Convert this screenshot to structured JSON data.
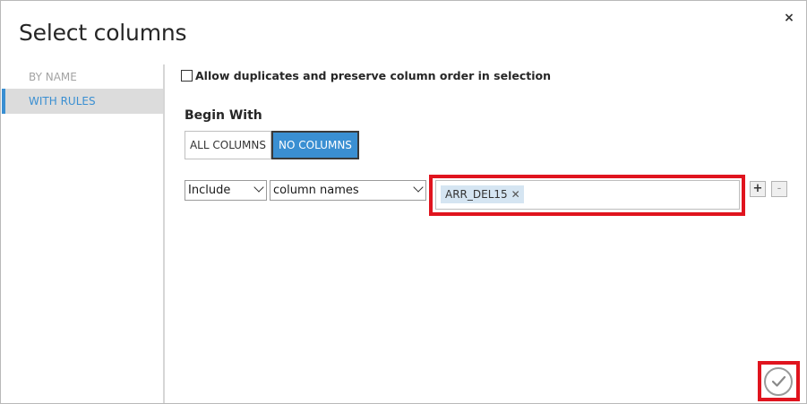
{
  "dialog": {
    "title": "Select columns",
    "close_icon": "close-icon",
    "close_glyph": "×"
  },
  "sidebar": {
    "items": [
      {
        "label": "BY NAME",
        "selected": false
      },
      {
        "label": "WITH RULES",
        "selected": true
      }
    ]
  },
  "options": {
    "allow_duplicates_label": "Allow duplicates and preserve column order in selection",
    "allow_duplicates_checked": false
  },
  "begin_with": {
    "label": "Begin With",
    "all_columns": "ALL COLUMNS",
    "no_columns": "NO COLUMNS",
    "selected": "NO COLUMNS"
  },
  "rule": {
    "include_value": "Include",
    "type_value": "column names",
    "tags": [
      "ARR_DEL15"
    ],
    "tag_remove_glyph": "✕",
    "add_label": "+",
    "remove_label": "-"
  },
  "footer": {
    "ok_icon": "checkmark-icon"
  },
  "colors": {
    "accent": "#3a8fd2",
    "highlight": "#e0141e",
    "tag_bg": "#d5e5f2"
  }
}
